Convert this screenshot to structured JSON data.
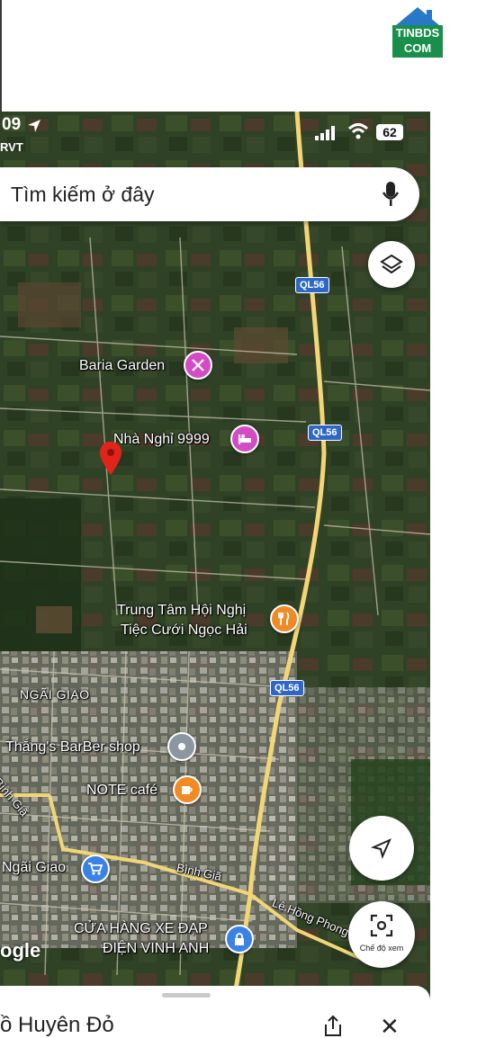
{
  "watermark": {
    "logo_top": "TINBDS",
    "logo_bottom": "COM",
    "brand_color": "#1a8f4b"
  },
  "status_bar": {
    "time": "09",
    "carrier": "RVT",
    "battery": "62"
  },
  "search": {
    "placeholder": "Tìm kiếm ở đây"
  },
  "road_badges": [
    "QL56",
    "QL56",
    "QL56"
  ],
  "places": {
    "baria_garden": "Baria Garden",
    "nha_nghi": "Nhà Nghỉ 9999",
    "trung_tam_line1": "Trung Tâm Hội Nghị",
    "trung_tam_line2": "Tiệc Cưới Ngọc Hải",
    "ngai_giao_area": "NGÃI GIAO",
    "barber": "Thắng's BarBer shop",
    "note_cafe": "NOTE café",
    "binh_gia_left": "Bình Giã",
    "ngai_giao_market": "Ngãi Giao",
    "binh_gia_road": "Bình Giã",
    "le_hong_phong": "Lê Hồng Phong",
    "cua_hang_line1": "CỬA HÀNG XE ĐẠP",
    "cua_hang_line2": "ĐIỆN VINH ANH"
  },
  "map_controls": {
    "view_mode_label": "Chế độ xem"
  },
  "google_mark": "ogle",
  "place_sheet": {
    "title": "ồ Huyên Đỏ"
  },
  "colors": {
    "poi_pink": "#d34cc4",
    "poi_orange": "#f08a24",
    "poi_gray": "#8c96a0",
    "poi_blue": "#3b82e6",
    "pin_red": "#e2231a",
    "road_yellow": "#f2d676",
    "badge_blue": "#2f67c9"
  },
  "icons": [
    "location-arrow-icon",
    "wifi-icon",
    "signal-icon",
    "mic-icon",
    "layers-icon",
    "navigate-icon",
    "camera-view-icon",
    "share-icon",
    "close-icon",
    "red-pin-icon",
    "restaurant-icon",
    "hotel-icon",
    "fork-knife-icon",
    "cafe-icon",
    "shopping-cart-icon",
    "lock-icon"
  ]
}
